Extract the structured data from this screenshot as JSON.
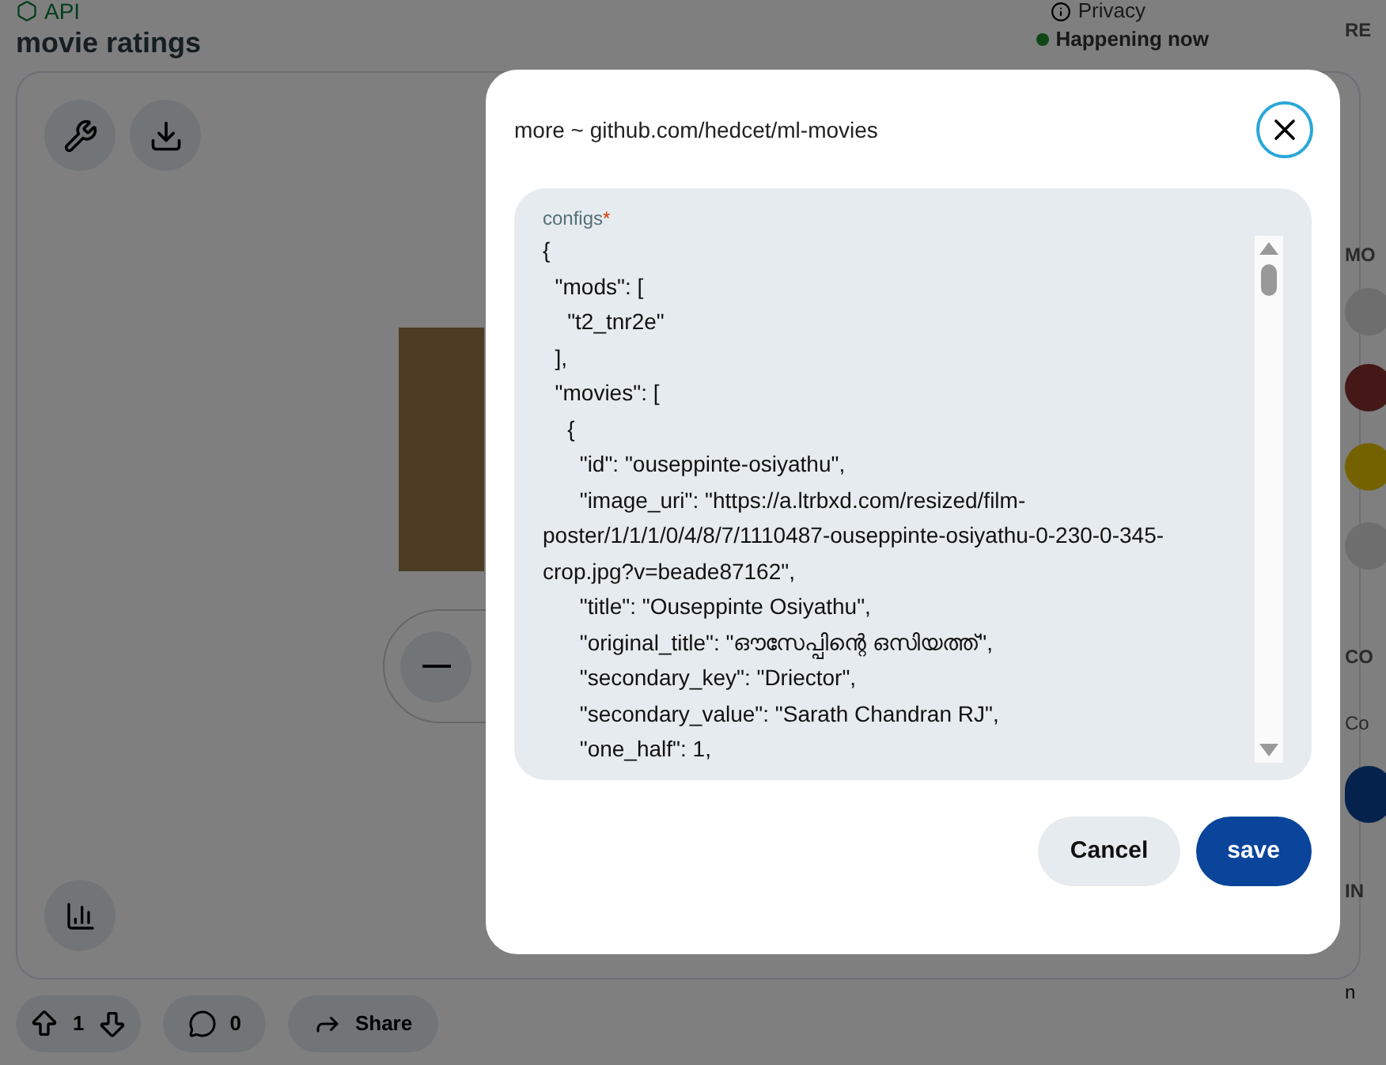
{
  "header": {
    "brand": "API",
    "privacy": "Privacy",
    "status": "Happening now",
    "title": "movie ratings"
  },
  "actions": {
    "votes": "1",
    "comments": "0",
    "share": "Share"
  },
  "sidebar": {
    "headings": [
      "RE",
      "MO",
      "CO",
      "Co",
      "IN",
      "n"
    ]
  },
  "dialog": {
    "title": "more ~ github.com/hedcet/ml-movies",
    "field": {
      "label": "configs",
      "required": true,
      "required_mark": "*",
      "value": "{\n  \"mods\": [\n    \"t2_tnr2e\"\n  ],\n  \"movies\": [\n    {\n      \"id\": \"ouseppinte-osiyathu\",\n      \"image_uri\": \"https://a.ltrbxd.com/resized/film-poster/1/1/1/0/4/8/7/1110487-ouseppinte-osiyathu-0-230-0-345-crop.jpg?v=beade87162\",\n      \"title\": \"Ouseppinte Osiyathu\",\n      \"original_title\": \"ഔസേപ്പിന്റെ ഒസിയത്ത്\",\n      \"secondary_key\": \"Driector\",\n      \"secondary_value\": \"Sarath Chandran RJ\",\n      \"one_half\": 1,"
    },
    "buttons": [
      {
        "label": "Cancel",
        "kind": "secondary"
      },
      {
        "label": "save",
        "kind": "primary"
      }
    ]
  }
}
